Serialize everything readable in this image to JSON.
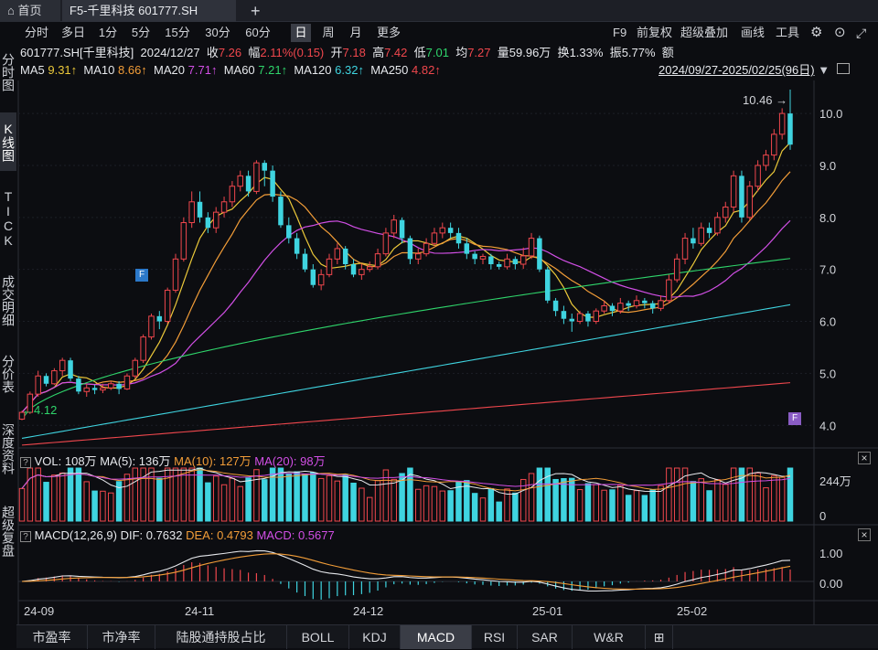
{
  "tabs": {
    "home": "首页",
    "active": "F5-千里科技 601777.SH",
    "add": "+"
  },
  "toolbar": {
    "periods": [
      "分时",
      "多日",
      "1分",
      "5分",
      "15分",
      "30分",
      "60分",
      "日",
      "周",
      "月",
      "更多"
    ],
    "selected": "日",
    "right": [
      "F9",
      "前复权",
      "超级叠加",
      "画线",
      "工具"
    ]
  },
  "leftnav": [
    "分时图",
    "K线图",
    "TICK",
    "成交明细",
    "分价表",
    "深度资料",
    "超级复盘"
  ],
  "quote": {
    "symbol": "601777.SH[千里科技]",
    "date": "2024/12/27",
    "close_label": "收",
    "close": "7.26",
    "change_label": "幅",
    "change": "2.11%(0.15)",
    "open_label": "开",
    "open": "7.18",
    "high_label": "高",
    "high": "7.42",
    "low_label": "低",
    "low": "7.01",
    "avg_label": "均",
    "avg": "7.27",
    "vol_label": "量",
    "vol": "59.96万",
    "turnover_label": "换",
    "turnover": "1.33%",
    "amp_label": "振",
    "amp": "5.77%",
    "amount_label": "额"
  },
  "ma": {
    "ma5_label": "MA5",
    "ma5": "9.31↑",
    "ma10_label": "MA10",
    "ma10": "8.66↑",
    "ma20_label": "MA20",
    "ma20": "7.71↑",
    "ma60_label": "MA60",
    "ma60": "7.21↑",
    "ma120_label": "MA120",
    "ma120": "6.32↑",
    "ma250_label": "MA250",
    "ma250": "4.82↑",
    "range": "2024/09/27-2025/02/25(96日)"
  },
  "price_axis": [
    "10.0",
    "9.0",
    "8.0",
    "7.0",
    "6.0",
    "5.0",
    "4.0"
  ],
  "markers": {
    "max": "10.46",
    "min": "4.12",
    "f": "F"
  },
  "vol_panel": {
    "title": "VOL: 108万",
    "ma5": "MA(5): 136万",
    "ma10": "MA(10): 127万",
    "ma20": "MA(20): 98万",
    "axis_top": "244万",
    "axis_zero": "0"
  },
  "macd_panel": {
    "title": "MACD(12,26,9)",
    "dif": "DIF: 0.7632",
    "dea": "DEA: 0.4793",
    "macd": "MACD: 0.5677",
    "axis_top": "1.00",
    "axis_zero": "0.00"
  },
  "date_axis": [
    "24-09",
    "24-11",
    "24-12",
    "25-01",
    "25-02"
  ],
  "bottom_tabs": [
    "市盈率",
    "市净率",
    "陆股通持股占比",
    "BOLL",
    "KDJ",
    "MACD",
    "RSI",
    "SAR",
    "W&R",
    "⊞"
  ],
  "bottom_selected": "MACD",
  "chart_data": {
    "type": "candlestick",
    "ylim": [
      3.6,
      10.6
    ],
    "candles": [
      [
        4.12,
        4.25,
        4.1,
        4.28
      ],
      [
        4.25,
        4.6,
        4.22,
        4.65
      ],
      [
        4.6,
        4.95,
        4.55,
        5.05
      ],
      [
        4.95,
        4.8,
        4.75,
        5.0
      ],
      [
        4.8,
        5.05,
        4.78,
        5.1
      ],
      [
        5.05,
        5.25,
        4.95,
        5.3
      ],
      [
        5.25,
        4.9,
        4.85,
        5.3
      ],
      [
        4.9,
        4.65,
        4.6,
        4.95
      ],
      [
        4.65,
        4.72,
        4.55,
        4.8
      ],
      [
        4.72,
        4.68,
        4.6,
        4.78
      ],
      [
        4.68,
        4.72,
        4.62,
        4.8
      ],
      [
        4.72,
        4.8,
        4.68,
        4.85
      ],
      [
        4.8,
        4.7,
        4.6,
        4.85
      ],
      [
        4.7,
        4.95,
        4.68,
        5.0
      ],
      [
        4.95,
        5.25,
        4.9,
        5.3
      ],
      [
        5.25,
        5.7,
        5.2,
        5.75
      ],
      [
        5.7,
        6.1,
        5.65,
        6.15
      ],
      [
        6.1,
        6.0,
        5.85,
        6.2
      ],
      [
        6.0,
        6.6,
        5.95,
        6.65
      ],
      [
        6.6,
        7.2,
        6.55,
        7.3
      ],
      [
        7.2,
        7.9,
        7.15,
        8.0
      ],
      [
        7.9,
        8.3,
        7.8,
        8.5
      ],
      [
        8.3,
        8.0,
        7.9,
        8.5
      ],
      [
        8.0,
        7.8,
        7.7,
        8.1
      ],
      [
        7.8,
        8.1,
        7.7,
        8.2
      ],
      [
        8.1,
        8.3,
        8.0,
        8.4
      ],
      [
        8.3,
        8.6,
        8.2,
        8.7
      ],
      [
        8.6,
        8.8,
        8.5,
        8.9
      ],
      [
        8.8,
        8.5,
        8.4,
        8.9
      ],
      [
        8.5,
        9.05,
        8.45,
        9.1
      ],
      [
        9.05,
        8.9,
        8.6,
        9.1
      ],
      [
        8.9,
        8.4,
        8.3,
        9.0
      ],
      [
        8.4,
        7.85,
        7.8,
        8.5
      ],
      [
        7.85,
        7.6,
        7.5,
        8.0
      ],
      [
        7.6,
        7.3,
        7.2,
        7.7
      ],
      [
        7.3,
        7.0,
        6.95,
        7.4
      ],
      [
        7.0,
        6.7,
        6.65,
        7.1
      ],
      [
        6.7,
        6.9,
        6.6,
        7.0
      ],
      [
        6.9,
        7.2,
        6.85,
        7.3
      ],
      [
        7.2,
        7.4,
        7.1,
        7.5
      ],
      [
        7.4,
        7.1,
        7.0,
        7.45
      ],
      [
        7.1,
        6.9,
        6.85,
        7.2
      ],
      [
        6.9,
        7.0,
        6.8,
        7.1
      ],
      [
        7.0,
        7.05,
        6.95,
        7.15
      ],
      [
        7.05,
        7.3,
        7.0,
        7.4
      ],
      [
        7.3,
        7.7,
        7.25,
        7.8
      ],
      [
        7.7,
        7.95,
        7.6,
        8.05
      ],
      [
        7.95,
        7.6,
        7.5,
        8.0
      ],
      [
        7.6,
        7.2,
        7.1,
        7.65
      ],
      [
        7.2,
        7.3,
        7.1,
        7.4
      ],
      [
        7.3,
        7.5,
        7.25,
        7.6
      ],
      [
        7.5,
        7.7,
        7.45,
        7.8
      ],
      [
        7.7,
        7.8,
        7.6,
        7.9
      ],
      [
        7.8,
        7.7,
        7.6,
        7.9
      ],
      [
        7.7,
        7.5,
        7.4,
        7.8
      ],
      [
        7.5,
        7.3,
        7.2,
        7.6
      ],
      [
        7.3,
        7.2,
        7.1,
        7.35
      ],
      [
        7.2,
        7.25,
        7.1,
        7.3
      ],
      [
        7.25,
        7.1,
        7.0,
        7.3
      ],
      [
        7.1,
        7.05,
        7.0,
        7.15
      ],
      [
        7.05,
        7.2,
        7.0,
        7.3
      ],
      [
        7.2,
        7.1,
        7.0,
        7.25
      ],
      [
        7.1,
        7.26,
        7.01,
        7.42
      ],
      [
        7.26,
        7.6,
        7.2,
        7.7
      ],
      [
        7.6,
        7.0,
        6.95,
        7.65
      ],
      [
        7.0,
        6.4,
        6.35,
        7.05
      ],
      [
        6.4,
        6.2,
        6.1,
        6.45
      ],
      [
        6.2,
        6.05,
        5.95,
        6.3
      ],
      [
        6.05,
        6.0,
        5.8,
        6.15
      ],
      [
        6.0,
        6.15,
        5.95,
        6.2
      ],
      [
        6.15,
        6.0,
        5.9,
        6.2
      ],
      [
        6.0,
        6.2,
        5.95,
        6.25
      ],
      [
        6.2,
        6.3,
        6.15,
        6.4
      ],
      [
        6.3,
        6.2,
        6.1,
        6.35
      ],
      [
        6.2,
        6.35,
        6.15,
        6.45
      ],
      [
        6.35,
        6.3,
        6.2,
        6.4
      ],
      [
        6.3,
        6.4,
        6.25,
        6.5
      ],
      [
        6.4,
        6.35,
        6.25,
        6.45
      ],
      [
        6.35,
        6.25,
        6.15,
        6.4
      ],
      [
        6.25,
        6.4,
        6.2,
        6.5
      ],
      [
        6.4,
        6.8,
        6.35,
        6.9
      ],
      [
        6.8,
        7.2,
        6.75,
        7.3
      ],
      [
        7.2,
        7.6,
        7.1,
        7.7
      ],
      [
        7.6,
        7.5,
        7.4,
        7.8
      ],
      [
        7.5,
        7.8,
        7.45,
        7.9
      ],
      [
        7.8,
        7.7,
        7.6,
        7.9
      ],
      [
        7.7,
        8.0,
        7.65,
        8.1
      ],
      [
        8.0,
        8.2,
        7.9,
        8.3
      ],
      [
        8.2,
        8.8,
        8.1,
        8.9
      ],
      [
        8.8,
        8.0,
        7.9,
        8.9
      ],
      [
        8.0,
        8.6,
        7.95,
        8.7
      ],
      [
        8.6,
        9.0,
        8.5,
        9.1
      ],
      [
        9.0,
        9.2,
        8.9,
        9.3
      ],
      [
        9.2,
        9.6,
        9.1,
        9.7
      ],
      [
        9.6,
        10.0,
        9.5,
        10.1
      ],
      [
        10.0,
        9.4,
        9.3,
        10.46
      ]
    ]
  }
}
